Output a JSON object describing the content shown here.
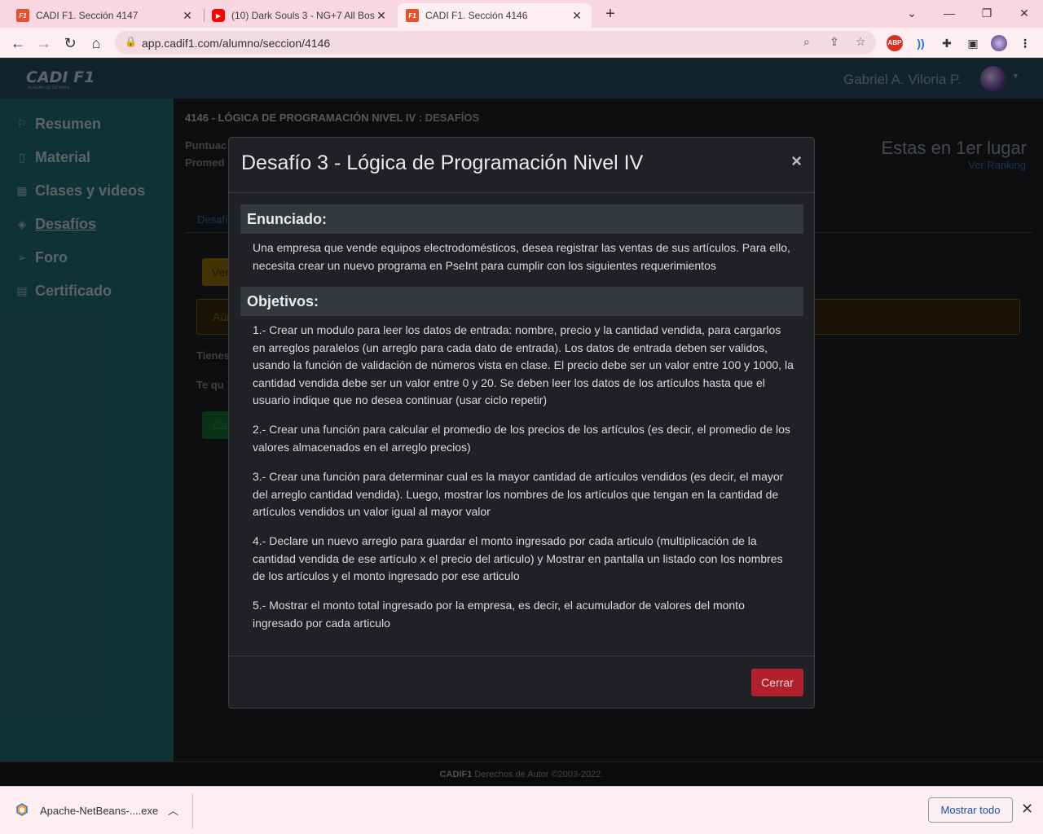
{
  "browser": {
    "tabs": [
      {
        "title": "CADI F1. Sección 4147",
        "favicon": "F1"
      },
      {
        "title": "(10) Dark Souls 3 - NG+7 All Bos",
        "favicon": "yt"
      },
      {
        "title": "CADI F1. Sección 4146",
        "favicon": "F1"
      }
    ],
    "url": "app.cadif1.com/alumno/seccion/4146",
    "extensions": [
      "ABP"
    ]
  },
  "header": {
    "logo_text": "CADI F1",
    "logo_sub": "ACADEMIA DE SOFTWARE",
    "username": "Gabriel A. Viloria P."
  },
  "sidebar": {
    "items": [
      {
        "label": "Resumen",
        "icon": "flag-icon"
      },
      {
        "label": "Material",
        "icon": "file-icon"
      },
      {
        "label": "Clases y videos",
        "icon": "calendar-icon"
      },
      {
        "label": "Desafíos",
        "icon": "gem-icon"
      },
      {
        "label": "Foro",
        "icon": "paper-plane-icon"
      },
      {
        "label": "Certificado",
        "icon": "certificate-icon"
      }
    ]
  },
  "content": {
    "breadcrumb": "4146 - LÓGICA DE PROGRAMACIÓN NIVEL IV",
    "breadcrumb_sub": " : DESAFÍOS",
    "puntuacion_label": "Puntuac",
    "promedio_label": "Promed",
    "rank_title": "Estas en 1er lugar",
    "rank_link": "Ver Ranking",
    "tab_label": "Desafí",
    "btn_yellow": "Ver",
    "alert_text": "Aún",
    "tienes_text": "Tienes",
    "te_que_text": "Te qu",
    "btn_green": "Car"
  },
  "modal": {
    "title": "Desafío 3 - Lógica de Programación Nivel IV",
    "close_symbol": "×",
    "enunciado_head": "Enunciado:",
    "enunciado_text": "Una empresa que vende equipos electrodomésticos, desea registrar las ventas de sus artículos. Para ello, necesita crear un nuevo programa en PseInt para cumplir con los siguientes requerimientos",
    "objetivos_head": "Objetivos:",
    "objetivos": [
      "1.- Crear un modulo para leer los datos de entrada: nombre, precio y la cantidad vendida, para cargarlos en arreglos paralelos (un arreglo para cada dato de entrada). Los datos de entrada deben ser validos, usando la función de validación de números vista en clase. El precio debe ser un valor entre 100 y 1000, la cantidad vendida debe ser un valor entre 0 y 20. Se deben leer los datos de los artículos hasta que el usuario indique que no desea continuar (usar ciclo repetir)",
      "2.- Crear una función para calcular el promedio de los precios de los artículos (es decir, el promedio de los valores almacenados en el arreglo precios)",
      "3.- Crear una función para determinar cual es la mayor cantidad de artículos vendidos (es decir, el mayor del arreglo cantidad vendida). Luego, mostrar los nombres de los artículos que tengan en la cantidad de artículos vendidos un valor igual al mayor valor",
      "4.- Declare un nuevo arreglo para guardar el monto ingresado por cada articulo (multiplicación de la cantidad vendida de ese artículo x el precio del articulo) y Mostrar en pantalla un listado con los nombres de los artículos y el monto ingresado por ese articulo",
      "5.- Mostrar el monto total ingresado por la empresa, es decir, el acumulador de valores del monto ingresado por cada articulo"
    ],
    "close_button": "Cerrar"
  },
  "footer": {
    "brand": "CADIF1",
    "text": " Derechos de Autor ©2003-2022."
  },
  "downloads": {
    "file": "Apache-NetBeans-....exe",
    "show_all": "Mostrar todo"
  },
  "colors": {
    "sidebar": "#1d5b65",
    "topnav": "#1f4050",
    "close_button": "#b21f2d",
    "chrome": "#f8d7e0"
  }
}
